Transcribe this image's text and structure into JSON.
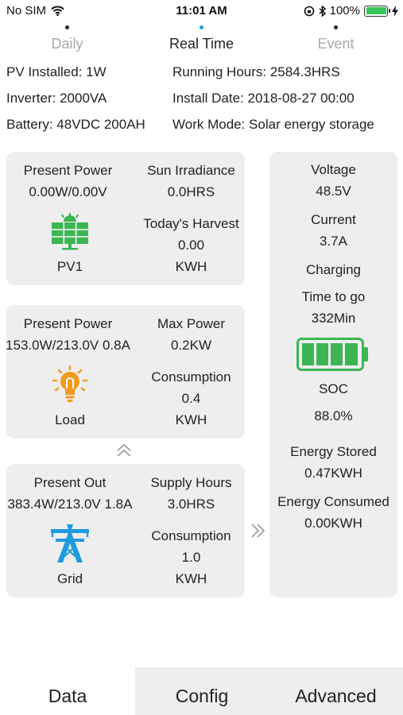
{
  "status_bar": {
    "carrier": "No SIM",
    "time": "11:01 AM",
    "battery_percent": "100%"
  },
  "top_tabs": [
    {
      "label": "Daily",
      "active": false
    },
    {
      "label": "Real Time",
      "active": true
    },
    {
      "label": "Event",
      "active": false
    }
  ],
  "info": {
    "pv_installed": "PV Installed: 1W",
    "running_hours": "Running Hours: 2584.3HRS",
    "inverter": "Inverter: 2000VA",
    "install_date": "Install Date: 2018-08-27 00:00",
    "battery": "Battery: 48VDC 200AH",
    "work_mode": "Work Mode: Solar energy storage"
  },
  "pv_card": {
    "present_power_label": "Present Power",
    "present_power_value": "0.00W/0.00V",
    "sun_irradiance_label": "Sun Irradiance",
    "sun_irradiance_value": "0.0HRS",
    "todays_harvest_label": "Today's Harvest",
    "todays_harvest_value": "0.00",
    "todays_harvest_unit": "KWH",
    "name": "PV1"
  },
  "load_card": {
    "present_power_label": "Present Power",
    "present_power_value": "153.0W/213.0V 0.8A",
    "max_power_label": "Max Power",
    "max_power_value": "0.2KW",
    "consumption_label": "Consumption",
    "consumption_value": "0.4",
    "consumption_unit": "KWH",
    "name": "Load"
  },
  "grid_card": {
    "present_out_label": "Present Out",
    "present_out_value": "383.4W/213.0V 1.8A",
    "supply_hours_label": "Supply Hours",
    "supply_hours_value": "3.0HRS",
    "consumption_label": "Consumption",
    "consumption_value": "1.0",
    "consumption_unit": "KWH",
    "name": "Grid"
  },
  "battery_card": {
    "voltage_label": "Voltage",
    "voltage_value": "48.5V",
    "current_label": "Current",
    "current_value": "3.7A",
    "state": "Charging",
    "time_to_go_label": "Time to go",
    "time_to_go_value": "332Min",
    "soc_label": "SOC",
    "soc_value": "88.0%",
    "energy_stored_label": "Energy Stored",
    "energy_stored_value": "0.47KWH",
    "energy_consumed_label": "Energy Consumed",
    "energy_consumed_value": "0.00KWH"
  },
  "bottom_tabs": [
    {
      "label": "Data",
      "active": true
    },
    {
      "label": "Config",
      "active": false
    },
    {
      "label": "Advanced",
      "active": false
    }
  ],
  "colors": {
    "pv_icon": "#3cb552",
    "battery_icon": "#3cb552",
    "load_icon": "#f39a1e",
    "grid_icon": "#1e9be0",
    "active_tab_dot": "#1e9be0",
    "card_bg": "#eeeeee"
  },
  "icons": {
    "pv": "solar-panel-icon",
    "load": "light-bulb-icon",
    "grid": "power-tower-icon",
    "battery": "battery-icon",
    "flow_up": "double-chevron-up-icon",
    "flow_right": "double-chevron-right-icon"
  }
}
